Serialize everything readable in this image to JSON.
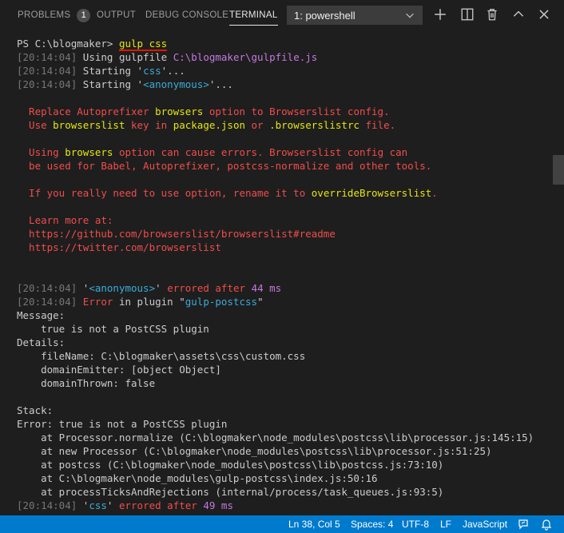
{
  "panel": {
    "tabs": [
      {
        "label": "PROBLEMS",
        "badge": "1"
      },
      {
        "label": "OUTPUT"
      },
      {
        "label": "DEBUG CONSOLE"
      },
      {
        "label": "TERMINAL",
        "active": true
      }
    ],
    "terminal_select": "1: powershell",
    "icons": [
      "plus-icon",
      "split-icon",
      "trash-icon",
      "chevron-up-icon",
      "close-icon"
    ]
  },
  "terminal": {
    "prompt": "PS C:\\blogmaker> ",
    "command": "gulp css",
    "lines": {
      "l1_ts": "[20:14:04]",
      "l1_text": " Using gulpfile ",
      "l1_path": "C:\\blogmaker\\gulpfile.js",
      "l2_ts": "[20:14:04]",
      "l2_a": " Starting '",
      "l2_b": "css",
      "l2_c": "'...",
      "l3_ts": "[20:14:04]",
      "l3_a": " Starting '",
      "l3_b": "<anonymous>",
      "l3_c": "'...",
      "w1_a": "  Replace Autoprefixer ",
      "w1_b": "browsers",
      "w1_c": " option to Browserslist config.",
      "w2_a": "  Use ",
      "w2_b": "browserslist",
      "w2_c": " key in ",
      "w2_d": "package.json",
      "w2_e": " or ",
      "w2_f": ".browserslistrc",
      "w2_g": " file.",
      "w3_a": "  Using ",
      "w3_b": "browsers",
      "w3_c": " option can cause errors. Browserslist config can",
      "w4": "  be used for Babel, Autoprefixer, postcss-normalize and other tools.",
      "w5_a": "  If you really need to use option, rename it to ",
      "w5_b": "overrideBrowserslist",
      "w5_c": ".",
      "w6": "  Learn more at:",
      "w7": "  https://github.com/browserslist/browserslist#readme",
      "w8": "  https://twitter.com/browserslist",
      "e1_ts": "[20:14:04]",
      "e1_a": " '",
      "e1_b": "<anonymous>",
      "e1_c": "' ",
      "e1_d": "errored after",
      "e1_e": " ",
      "e1_f": "44 ms",
      "e2_ts": "[20:14:04]",
      "e2_a": " ",
      "e2_b": "Error",
      "e2_c": " in plugin \"",
      "e2_d": "gulp-postcss",
      "e2_e": "\"",
      "m1": "Message:",
      "m2": "    true is not a PostCSS plugin",
      "d1": "Details:",
      "d2": "    fileName: C:\\blogmaker\\assets\\css\\custom.css",
      "d3": "    domainEmitter: [object Object]",
      "d4": "    domainThrown: false",
      "s1": "Stack:",
      "s2": "Error: true is not a PostCSS plugin",
      "s3": "    at Processor.normalize (C:\\blogmaker\\node_modules\\postcss\\lib\\processor.js:145:15)",
      "s4": "    at new Processor (C:\\blogmaker\\node_modules\\postcss\\lib\\processor.js:51:25)",
      "s5": "    at postcss (C:\\blogmaker\\node_modules\\postcss\\lib\\postcss.js:73:10)",
      "s6": "    at C:\\blogmaker\\node_modules\\gulp-postcss\\index.js:50:16",
      "s7": "    at processTicksAndRejections (internal/process/task_queues.js:93:5)",
      "f_ts": "[20:14:04]",
      "f_a": " '",
      "f_b": "css",
      "f_c": "' ",
      "f_d": "errored after",
      "f_e": " ",
      "f_f": "49 ms"
    }
  },
  "statusbar": {
    "position": "Ln 38, Col 5",
    "spaces": "Spaces: 4",
    "encoding": "UTF-8",
    "eol": "LF",
    "language": "JavaScript",
    "icons": [
      "feedback-icon",
      "bell-icon"
    ]
  },
  "colors": {
    "statusbar": "#007acc",
    "background": "#1e1e1e"
  }
}
